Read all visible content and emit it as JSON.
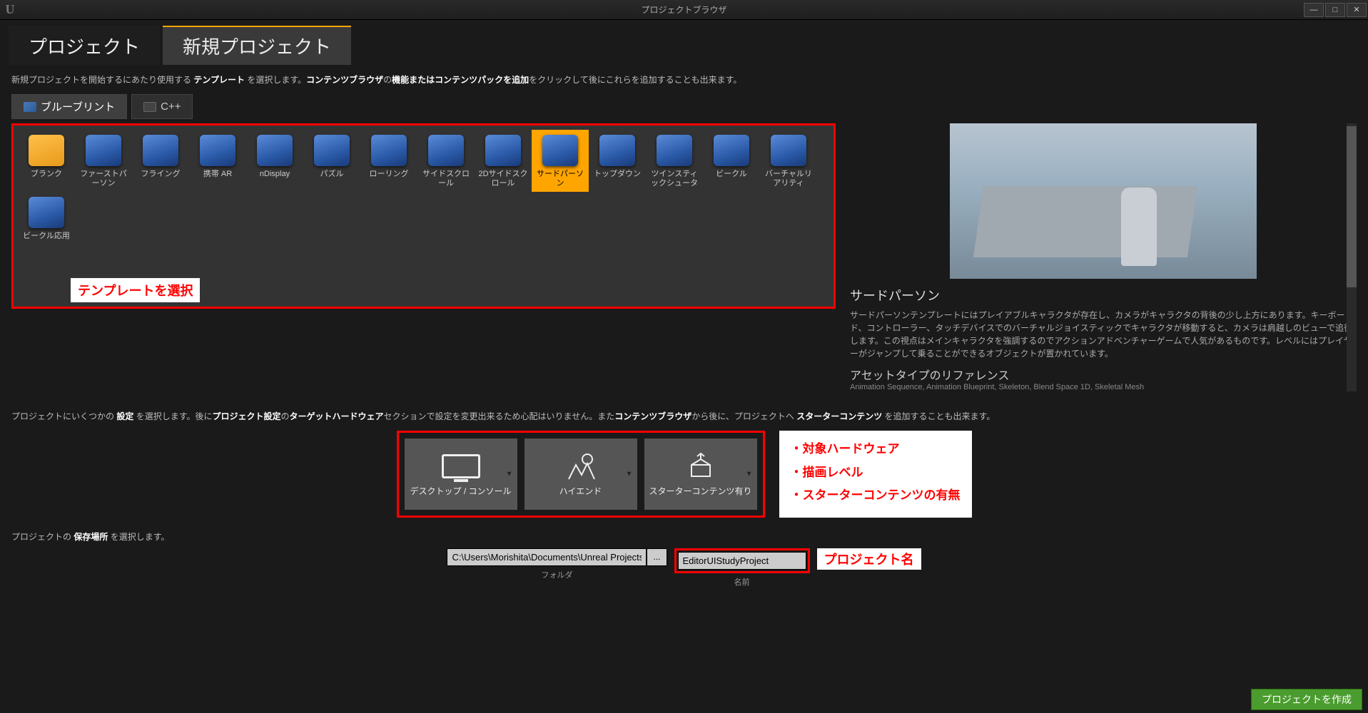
{
  "window": {
    "title": "プロジェクトブラウザ"
  },
  "main_tabs": {
    "projects": "プロジェクト",
    "new_project": "新規プロジェクト"
  },
  "help1_pre": "新規プロジェクトを開始するにあたり使用する ",
  "help1_b1": "テンプレート",
  "help1_mid": " を選択します。",
  "help1_b2": "コンテンツブラウザ",
  "help1_mid2": "の",
  "help1_b3": "機能またはコンテンツパックを追加",
  "help1_post": "をクリックして後にこれらを追加することも出来ます。",
  "sub_tabs": {
    "blueprint": "ブルーブリント",
    "cpp": "C++"
  },
  "templates": [
    {
      "label": "ブランク",
      "folder": true
    },
    {
      "label": "ファーストパーソン"
    },
    {
      "label": "フライング"
    },
    {
      "label": "携帯 AR"
    },
    {
      "label": "nDisplay"
    },
    {
      "label": "パズル"
    },
    {
      "label": "ローリング"
    },
    {
      "label": "サイドスクロール"
    },
    {
      "label": "2Dサイドスクロール"
    },
    {
      "label": "サードパーソン",
      "selected": true
    },
    {
      "label": "トップダウン"
    },
    {
      "label": "ツインスティックシュータ"
    },
    {
      "label": "ビークル"
    },
    {
      "label": "バーチャルリアリティ"
    },
    {
      "label": "ビークル応用"
    }
  ],
  "anno_template": "テンプレートを選択",
  "preview": {
    "title": "サードパーソン",
    "body": "サードパーソンテンプレートにはプレイアブルキャラクタが存在し、カメラがキャラクタの背後の少し上方にあります。キーボード、コントローラー、タッチデバイスでのバーチャルジョイスティックでキャラクタが移動すると、カメラは肩越しのビューで追従します。この視点はメインキャラクタを強調するのでアクションアドベンチャーゲームで人気があるものです。レベルにはプレイヤーがジャンプして乗ることができるオブジェクトが置かれています。",
    "asset_title": "アセットタイプのリファレンス",
    "asset_body": "Animation Sequence, Animation Blueprint, Skeleton, Blend Space 1D, Skeletal Mesh"
  },
  "help2_pre": "プロジェクトにいくつかの ",
  "help2_b1": "設定",
  "help2_mid1": " を選択します。後に",
  "help2_b2": "プロジェクト設定",
  "help2_mid2": "の",
  "help2_b3": "ターゲットハードウェア",
  "help2_mid3": "セクションで設定を変更出来るため心配はいりません。また",
  "help2_b4": "コンテンツブラウザ",
  "help2_mid4": "から後に、プロジェクトへ ",
  "help2_b5": "スターターコンテンツ",
  "help2_post": " を追加することも出来ます。",
  "settings": {
    "hardware": "デスクトップ / コンソール",
    "quality": "ハイエンド",
    "starter": "スターターコンテンツ有り"
  },
  "settings_anno": {
    "l1": "・対象ハードウェア",
    "l2": "・描画レベル",
    "l3": "・スターターコンテンツの有無"
  },
  "save_help_pre": "プロジェクトの ",
  "save_help_b": "保存場所",
  "save_help_post": " を選択します。",
  "path": {
    "folder_value": "C:\\Users\\Morishita\\Documents\\Unreal Projects",
    "folder_label": "フォルダ",
    "browse": "...",
    "name_value": "EditorUIStudyProject",
    "name_label": "名前"
  },
  "anno_name": "プロジェクト名",
  "create_button": "プロジェクトを作成"
}
